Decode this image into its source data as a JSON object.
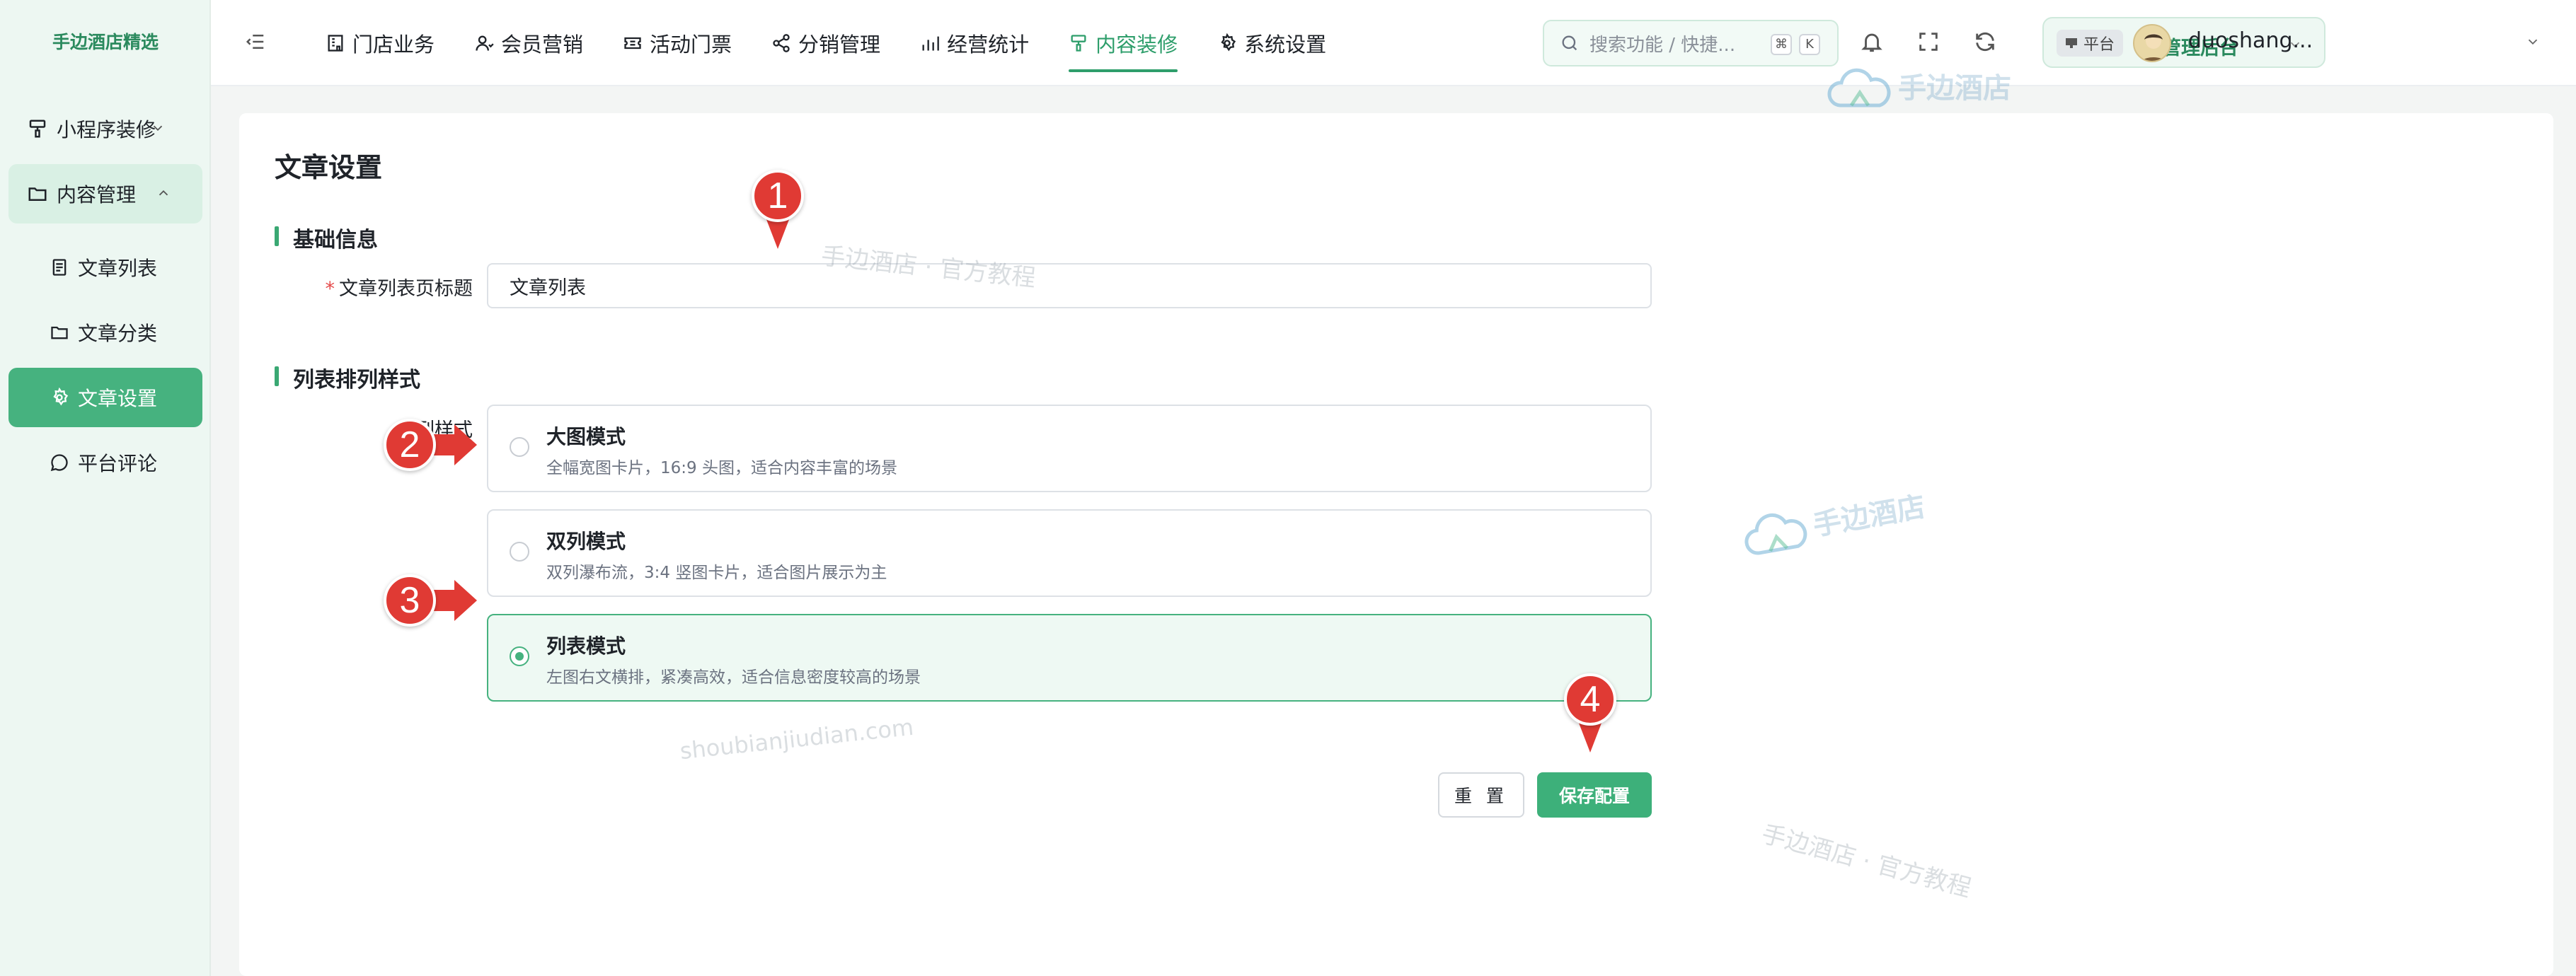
{
  "sidebar": {
    "brand": "手边酒店精选",
    "groups": [
      {
        "label": "小程序装修",
        "state": "collapsed"
      },
      {
        "label": "内容管理",
        "state": "expanded"
      }
    ],
    "items": [
      {
        "label": "文章列表"
      },
      {
        "label": "文章分类"
      },
      {
        "label": "文章设置",
        "active": true
      },
      {
        "label": "平台评论"
      }
    ]
  },
  "topbar": {
    "nav": [
      {
        "label": "门店业务",
        "icon": "store-icon"
      },
      {
        "label": "会员营销",
        "icon": "member-icon"
      },
      {
        "label": "活动门票",
        "icon": "ticket-icon"
      },
      {
        "label": "分销管理",
        "icon": "share-icon"
      },
      {
        "label": "经营统计",
        "icon": "bar-chart-icon"
      },
      {
        "label": "内容装修",
        "icon": "brush-icon",
        "active": true
      },
      {
        "label": "系统设置",
        "icon": "gear-icon"
      }
    ],
    "search_placeholder": "搜索功能 / 快捷...",
    "search_keys": [
      "⌘",
      "K"
    ],
    "platform_tag": "平台",
    "platform_name": "总管理后台",
    "username": "duoshang..."
  },
  "main": {
    "page_title": "文章设置",
    "sections": {
      "basic": "基础信息",
      "layout": "列表排列样式"
    },
    "list_title_label": "文章列表页标题",
    "list_title_value": "文章列表",
    "layout_label_partial": "列样式",
    "options": [
      {
        "title": "大图模式",
        "desc": "全幅宽图卡片，16:9 头图，适合内容丰富的场景",
        "selected": false
      },
      {
        "title": "双列模式",
        "desc": "双列瀑布流，3:4 竖图卡片，适合图片展示为主",
        "selected": false
      },
      {
        "title": "列表模式",
        "desc": "左图右文横排，紧凑高效，适合信息密度较高的场景",
        "selected": true
      }
    ],
    "buttons": {
      "reset": "重 置",
      "save": "保存配置"
    }
  },
  "annotations": [
    "1",
    "2",
    "3",
    "4"
  ],
  "watermarks": {
    "logo_text": "手边酒店",
    "tutorial": "手边酒店 · 官方教程",
    "domain": "shoubianjiudian.com"
  },
  "colors": {
    "accent": "#3db07a",
    "sidebar_bg": "#edf7f2",
    "marker": "#e03a34"
  }
}
